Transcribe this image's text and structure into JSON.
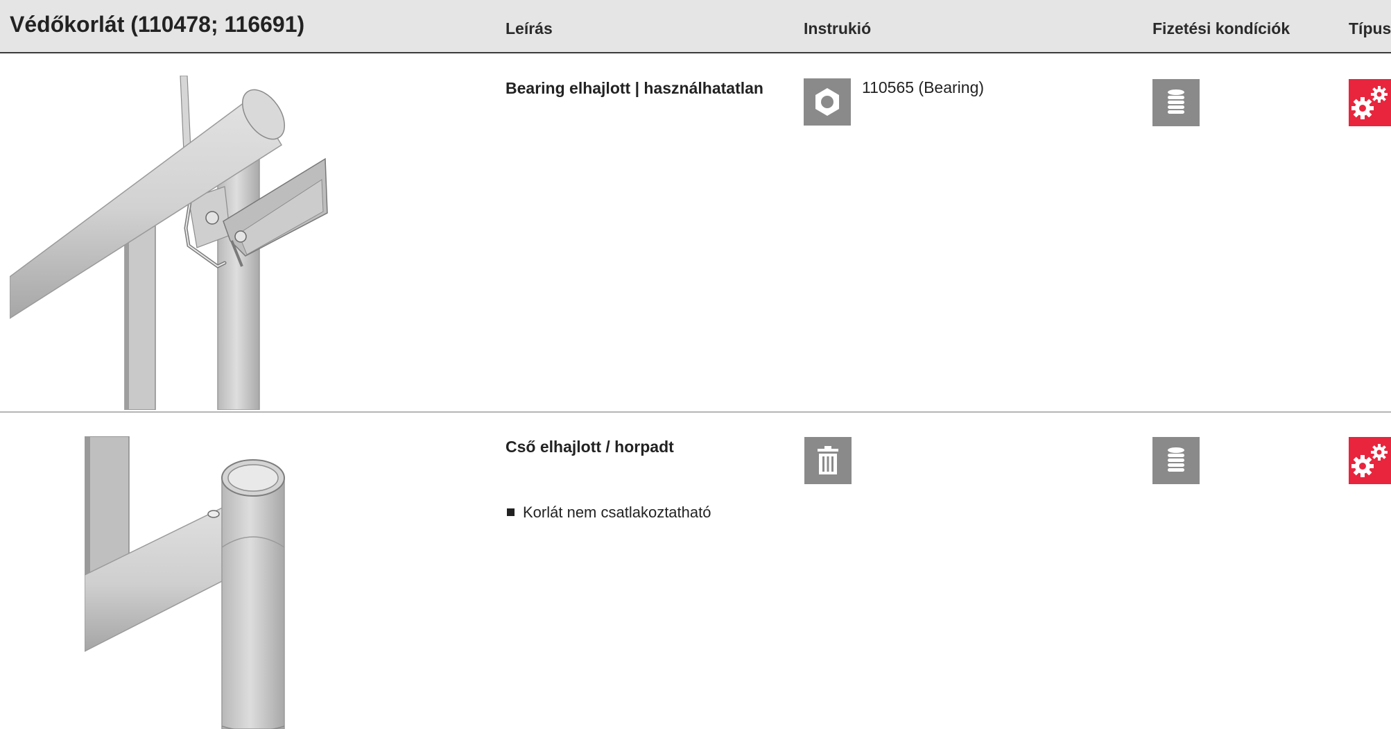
{
  "header": {
    "title": "Védőkorlát  (110478; 116691)",
    "columns": {
      "description": "Leírás",
      "instruction": "Instrukió",
      "payment": "Fizetési kondíciók",
      "type": "Típus"
    }
  },
  "rows": [
    {
      "illustration": "guardrail-bearing-illustration",
      "description": "Bearing elhajlott | használhatatlan",
      "bullet": "",
      "instruction_icon": "hex-nut-icon",
      "instruction_text": "110565 (Bearing)",
      "payment_icon": "coin-stack-icon",
      "type_icon": "gears-icon"
    },
    {
      "illustration": "guardrail-tube-illustration",
      "description": "Cső elhajlott / horpadt",
      "bullet": "Korlát nem csatlakoztatható",
      "instruction_icon": "trash-icon",
      "instruction_text": "",
      "payment_icon": "coin-stack-icon",
      "type_icon": "gears-icon"
    }
  ],
  "colors": {
    "header_bg": "#e5e5e5",
    "icon_gray": "#8a8a8a",
    "type_red": "#e8253d"
  }
}
